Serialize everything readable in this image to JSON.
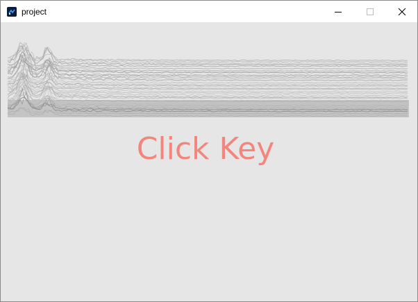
{
  "window": {
    "title": "project",
    "icon": "app-icon",
    "controls": [
      "minimize-icon",
      "maximize-icon",
      "close-icon"
    ]
  },
  "canvas": {
    "background": "#e6e6e6",
    "waveform_color": "#a0a0a0",
    "prompt_text": "Click Key",
    "prompt_color": "#f4857c"
  }
}
